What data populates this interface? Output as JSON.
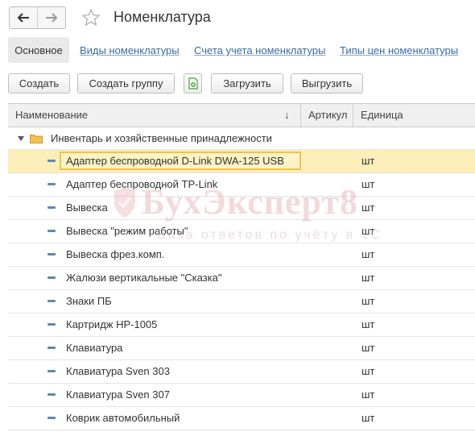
{
  "header": {
    "title": "Номенклатура",
    "back_icon": "arrow-left-icon",
    "forward_icon": "arrow-right-icon",
    "favorite_icon": "star-icon"
  },
  "tabs": [
    {
      "label": "Основное",
      "active": true
    },
    {
      "label": "Виды номенклатуры",
      "active": false
    },
    {
      "label": "Счета учета номенклатуры",
      "active": false
    },
    {
      "label": "Типы цен номенклатуры",
      "active": false
    }
  ],
  "toolbar": {
    "create_label": "Создать",
    "create_group_label": "Создать группу",
    "copy_icon": "copy-document-icon",
    "load_label": "Загрузить",
    "unload_label": "Выгрузить"
  },
  "table": {
    "columns": {
      "name": "Наименование",
      "sort_indicator": "↓",
      "article": "Артикул",
      "unit": "Единица"
    },
    "group": {
      "label": "Инвентарь и хозяйственные принадлежности",
      "icon": "folder-icon",
      "expanded": true
    },
    "rows": [
      {
        "name": "Адаптер беспроводной D-Link DWA-125 USB",
        "article": "",
        "unit": "шт",
        "selected": true
      },
      {
        "name": "Адаптер беспроводной TP-Link",
        "article": "",
        "unit": "шт"
      },
      {
        "name": "Вывеска",
        "article": "",
        "unit": "шт"
      },
      {
        "name": "Вывеска \"режим работы\"",
        "article": "",
        "unit": "шт"
      },
      {
        "name": "Вывеска фрез.комп.",
        "article": "",
        "unit": "шт"
      },
      {
        "name": "Жалюзи вертикальные \"Сказка\"",
        "article": "",
        "unit": "шт"
      },
      {
        "name": "Знаки ПБ",
        "article": "",
        "unit": "шт"
      },
      {
        "name": "Картридж HP-1005",
        "article": "",
        "unit": "шт"
      },
      {
        "name": "Клавиатура",
        "article": "",
        "unit": "шт"
      },
      {
        "name": "Клавиатура Sven 303",
        "article": "",
        "unit": "шт"
      },
      {
        "name": "Клавиатура Sven 307",
        "article": "",
        "unit": "шт"
      },
      {
        "name": "Коврик автомобильный",
        "article": "",
        "unit": "шт"
      }
    ]
  },
  "watermark": {
    "main": "БухЭксперт8",
    "sub": "База ответов по учёту в 1С"
  },
  "colors": {
    "link": "#3b6ba6",
    "selected_row": "#fbeeb8",
    "selected_border": "#f0c44c",
    "item_marker": "#5f86b3",
    "folder": "#f2c14e"
  }
}
